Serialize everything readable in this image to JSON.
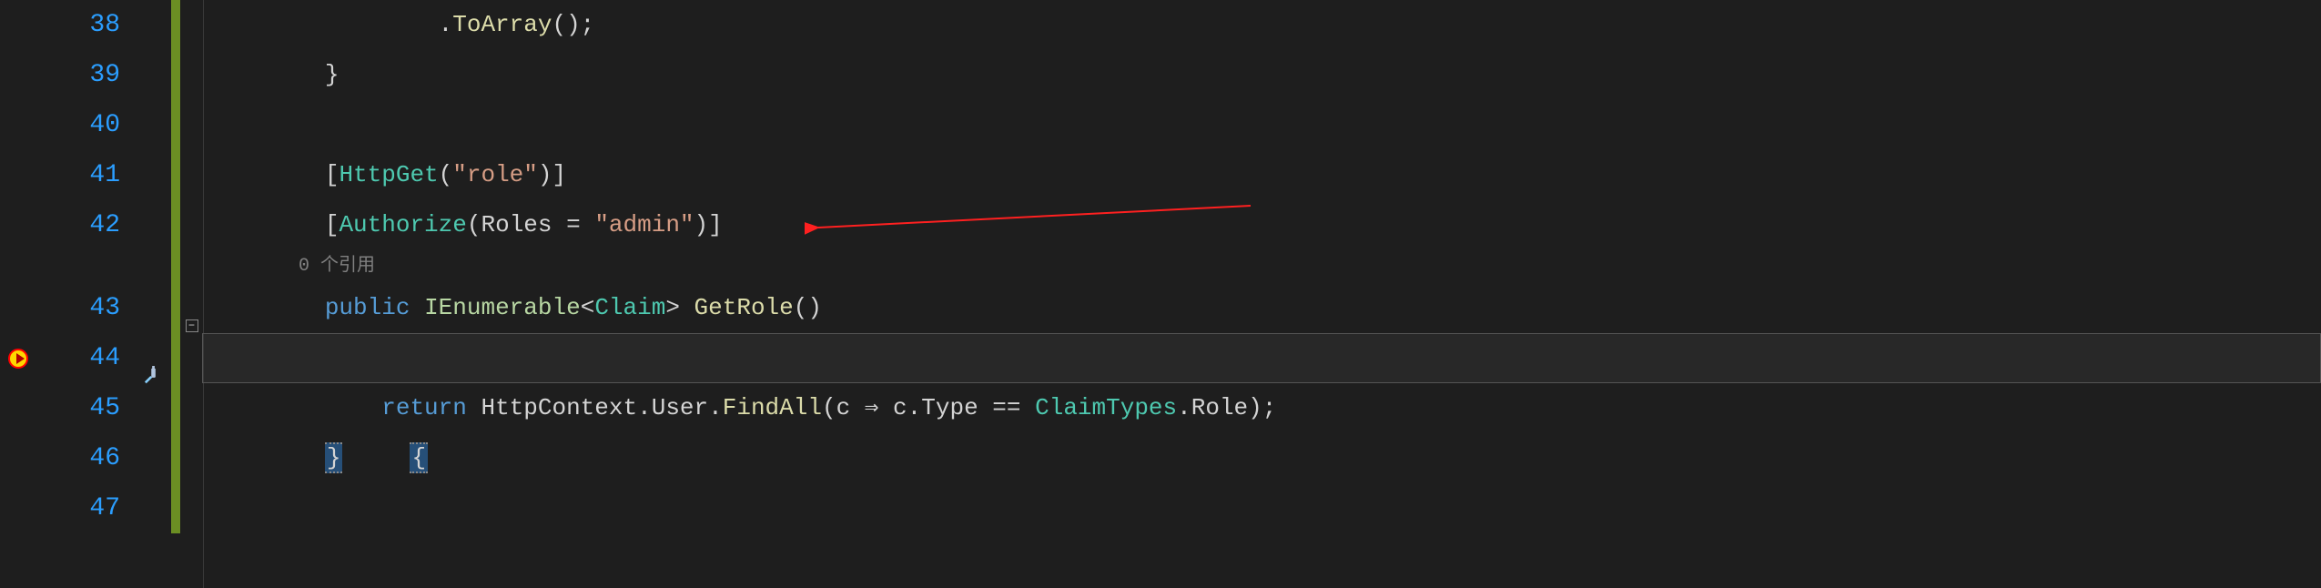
{
  "lines": {
    "n38": "38",
    "n39": "39",
    "n40": "40",
    "n41": "41",
    "n42": "42",
    "n43": "43",
    "n44": "44",
    "n45": "45",
    "n46": "46",
    "n47": "47"
  },
  "code": {
    "l38": {
      "indent": "                ",
      "dot": ".",
      "method": "ToArray",
      "paren": "();"
    },
    "l39": {
      "indent": "        ",
      "brace": "}"
    },
    "l40": {
      "indent": ""
    },
    "l41": {
      "indent": "        ",
      "b1": "[",
      "attr": "HttpGet",
      "p1": "(",
      "str": "\"role\"",
      "p2": ")",
      "b2": "]"
    },
    "l42": {
      "indent": "        ",
      "b1": "[",
      "attr": "Authorize",
      "p1": "(",
      "param": "Roles",
      "eq": " = ",
      "str": "\"admin\"",
      "p2": ")",
      "b2": "]"
    },
    "refs": {
      "indent": "        ",
      "text": "0 个引用"
    },
    "l43": {
      "indent": "        ",
      "kw1": "public",
      "sp1": " ",
      "type1": "IEnumerable",
      "lt": "<",
      "type2": "Claim",
      "gt": ">",
      "sp2": " ",
      "method": "GetRole",
      "paren": "()"
    },
    "l44": {
      "indent": "        ",
      "brace": "{"
    },
    "l45": {
      "indent": "            ",
      "kw": "return",
      "sp": " ",
      "p1": "HttpContext",
      "d1": ".",
      "p2": "User",
      "d2": ".",
      "m": "FindAll",
      "po": "(",
      "arg": "c",
      "arrow": " ⇒ ",
      "p3": "c",
      "d3": ".",
      "p4": "Type",
      "eq": " == ",
      "type": "ClaimTypes",
      "d4": ".",
      "p5": "Role",
      "pc": ");"
    },
    "l46": {
      "indent": "        ",
      "brace": "}"
    },
    "l47": {
      "indent": ""
    }
  },
  "fold": {
    "minus": "−"
  }
}
